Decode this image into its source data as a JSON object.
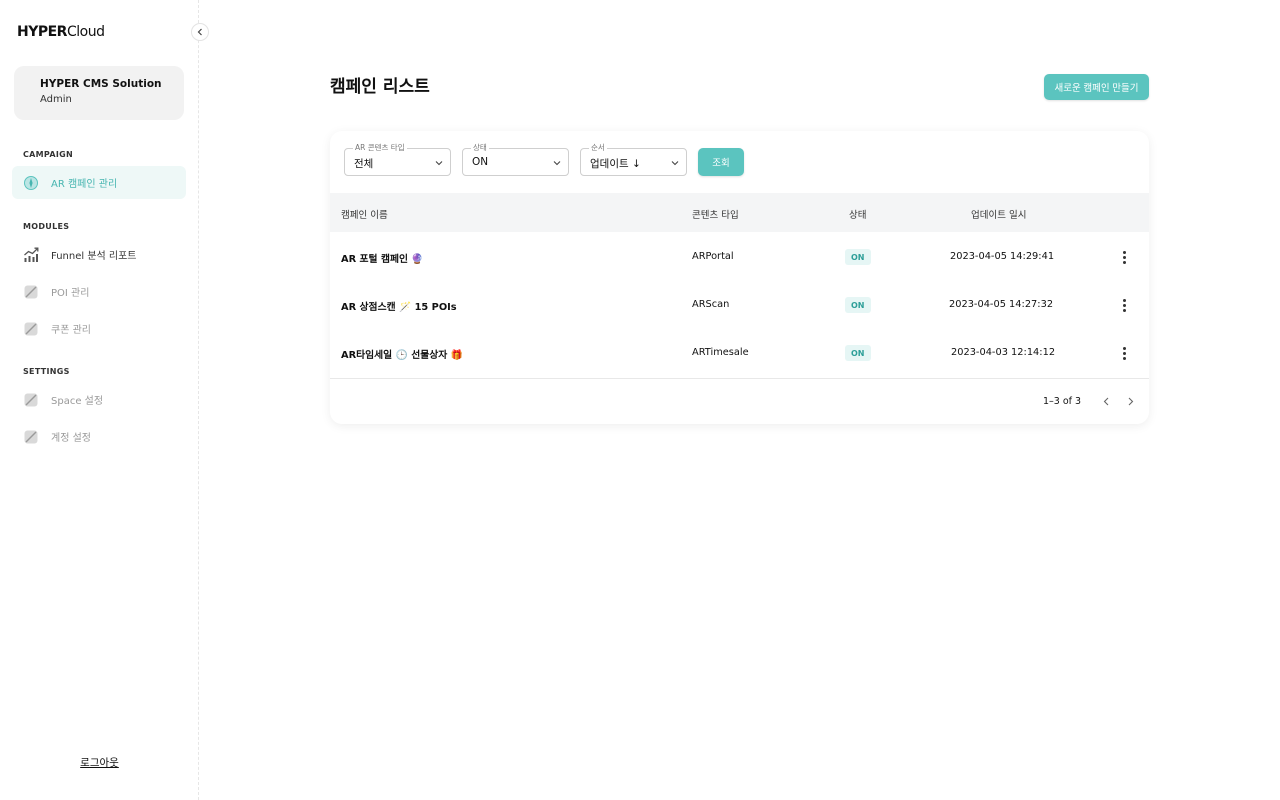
{
  "brand": {
    "logo_bold": "HYPER",
    "logo_light": "Cloud"
  },
  "account": {
    "name": "HYPER CMS Solution",
    "role": "Admin"
  },
  "sidebar": {
    "sections": [
      {
        "label": "CAMPAIGN",
        "items": [
          {
            "label": "AR 캠페인 관리",
            "icon": "compass-icon",
            "state": "active"
          }
        ]
      },
      {
        "label": "MODULES",
        "items": [
          {
            "label": "Funnel 분석 리포트",
            "icon": "chart-trend-icon",
            "state": "normal"
          },
          {
            "label": "POI 관리",
            "icon": "disabled-icon",
            "state": "disabled"
          },
          {
            "label": "쿠폰 관리",
            "icon": "disabled-icon",
            "state": "disabled"
          }
        ]
      },
      {
        "label": "SETTINGS",
        "items": [
          {
            "label": "Space 설정",
            "icon": "disabled-icon",
            "state": "disabled"
          },
          {
            "label": "계정 설정",
            "icon": "disabled-icon",
            "state": "disabled"
          }
        ]
      }
    ],
    "logout_label": "로그아웃"
  },
  "main": {
    "title": "캠페인 리스트",
    "create_button": "새로운 캠페인 만들기"
  },
  "filters": {
    "content_type": {
      "legend": "AR 콘텐츠 타입",
      "value": "전체"
    },
    "status": {
      "legend": "상태",
      "value": "ON"
    },
    "order": {
      "legend": "순서",
      "value": "업데이트 ↓"
    },
    "search_button": "조회"
  },
  "table": {
    "headers": [
      "캠페인 이름",
      "콘텐츠 타입",
      "상태",
      "업데이트 일시"
    ],
    "rows": [
      {
        "name": "AR 포털 캠페인 🔮",
        "type": "ARPortal",
        "status": "ON",
        "updated": "2023-04-05 14:29:41"
      },
      {
        "name": "AR 상점스캔 🪄 15 POIs",
        "type": "ARScan",
        "status": "ON",
        "updated": "2023-04-05 14:27:32"
      },
      {
        "name": "AR타임세일 🕒 선물상자 🎁",
        "type": "ARTimesale",
        "status": "ON",
        "updated": "2023-04-03 12:14:12"
      }
    ],
    "pagination": "1–3 of 3"
  },
  "colors": {
    "accent": "#5bc4bf",
    "accent_text": "#46b5b0",
    "badge_bg": "#e6f6f5",
    "badge_text": "#2e9f99"
  }
}
